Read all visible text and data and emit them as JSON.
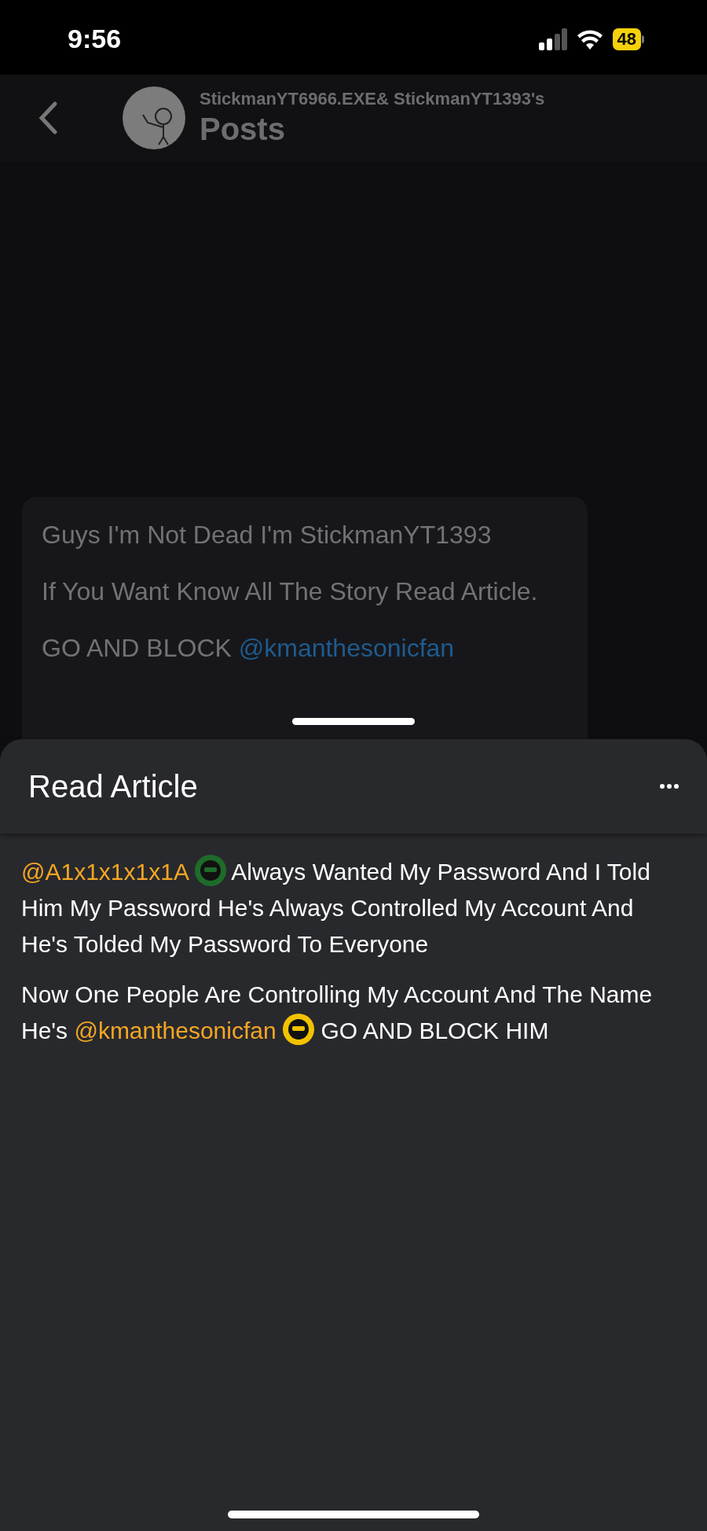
{
  "status_bar": {
    "time": "9:56",
    "battery": "48"
  },
  "header": {
    "subtitle": "StickmanYT6966.EXE& StickmanYT1393's",
    "title": "Posts"
  },
  "post": {
    "paragraphs": [
      "Guys I'm Not Dead I'm StickmanYT1393",
      "If You Want Know All The Story Read Article."
    ],
    "cut_line": [
      {
        "kind": "text",
        "text": "GO AND BLOCK"
      },
      {
        "kind": "mention",
        "text": "@kmanthesonicfan"
      }
    ]
  },
  "sheet": {
    "title": "Read Article",
    "paragraphs": [
      [
        {
          "kind": "mention",
          "text": "@A1x1x1x1x1A"
        },
        {
          "kind": "avatar",
          "color": "#1f6b2a"
        },
        {
          "kind": "text",
          "text": "Always Wanted My Password And I Told Him My Password He's Always Controlled My Account And He's Tolded My Password To Everyone"
        }
      ],
      [
        {
          "kind": "text",
          "text": "Now One People Are Controlling My Account And The Name He's"
        },
        {
          "kind": "mention",
          "text": "@kmanthesonicfan"
        },
        {
          "kind": "avatar",
          "color": "#f2c200"
        },
        {
          "kind": "text",
          "text": "GO AND BLOCK HIM"
        }
      ]
    ]
  }
}
